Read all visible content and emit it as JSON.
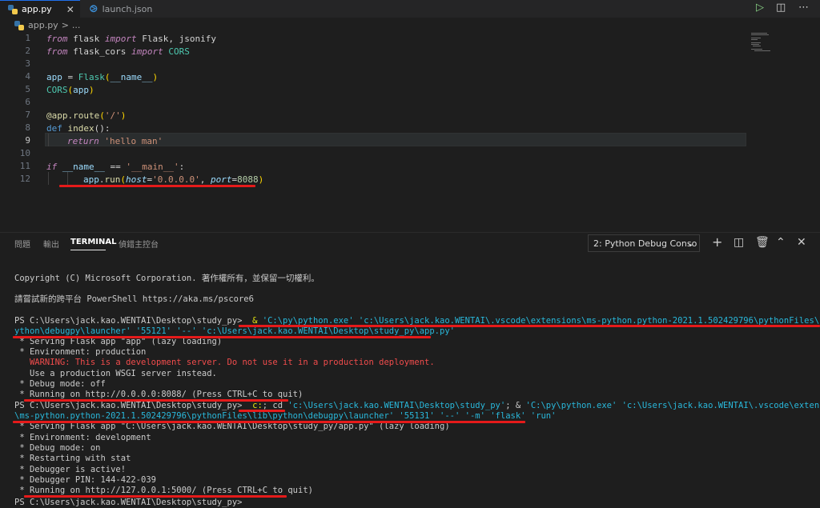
{
  "tabs": [
    {
      "label": "app.py",
      "active": true
    },
    {
      "label": "launch.json",
      "active": false
    }
  ],
  "breadcrumb": {
    "file": "app.py",
    "sep": ">",
    "rest": "..."
  },
  "editor": {
    "line_numbers": [
      "1",
      "2",
      "3",
      "4",
      "5",
      "6",
      "7",
      "8",
      "9",
      "10",
      "11",
      "12"
    ],
    "line1": {
      "t1": "from",
      "t2": " flask ",
      "t3": "import",
      "t4": " Flask, jsonify"
    },
    "line2": {
      "t1": "from",
      "t2": " flask_cors ",
      "t3": "import",
      "t4": " CORS"
    },
    "line4": {
      "t1": "app",
      "t2": " = ",
      "t3": "Flask",
      "t4": "(",
      "t5": "__name__",
      "t6": ")"
    },
    "line5": {
      "t1": "CORS",
      "t2": "(",
      "t3": "app",
      "t4": ")"
    },
    "line7": {
      "t1": "@app.route",
      "t2": "(",
      "t3": "'/'",
      "t4": ")"
    },
    "line8": {
      "t1": "def",
      "t2": " ",
      "t3": "index",
      "t4": "():"
    },
    "line9": {
      "t1": "return",
      "t2": " ",
      "t3": "'hello man'"
    },
    "line11": {
      "t1": "if",
      "t2": " ",
      "t3": "__name__",
      "t4": " == ",
      "t5": "'__main__'",
      "t6": ":"
    },
    "line12": {
      "t1": "app",
      "t2": ".",
      "t3": "run",
      "t4": "(",
      "t5": "host",
      "t6": "=",
      "t7": "'0.0.0.0'",
      "t8": ", ",
      "t9": "port",
      "t10": "=",
      "t11": "8088",
      "t12": ")"
    }
  },
  "panel": {
    "tabs": [
      "問題",
      "輸出",
      "TERMINAL",
      "偵錯主控台"
    ],
    "active_tab": "TERMINAL",
    "terminal_select": "2: Python Debug Conso"
  },
  "terminal": {
    "l1": "Copyright (C) Microsoft Corporation. 著作權所有，並保留一切權利。",
    "l2": "請嘗試新的跨平台 PowerShell https://aka.ms/pscore6",
    "l3a": "PS C:\\Users\\jack.kao.WENTAI\\Desktop\\study_py> ",
    "l3b": " & ",
    "l3c": "'C:\\py\\python.exe' 'c:\\Users\\jack.kao.WENTAI\\.vscode\\extensions\\ms-python.python-2021.1.502429796\\pythonFiles\\lib\\p",
    "l4": "ython\\debugpy\\launcher' '55121' '--' 'c:\\Users\\jack.kao.WENTAI\\Desktop\\study_py\\app.py'",
    "l5": " * Serving Flask app \"app\" (lazy loading)",
    "l6": " * Environment: production",
    "l7": "   WARNING: This is a development server. Do not use it in a production deployment.",
    "l8": "   Use a production WSGI server instead.",
    "l9": " * Debug mode: off",
    "l10": " * Running on http://0.0.0.0:8088/ (Press CTRL+C to quit)",
    "l11a": "PS C:\\Users\\jack.kao.WENTAI\\Desktop\\study_py> ",
    "l11b": " c:",
    "l11c": "; cd ",
    "l11d": "'c:\\Users\\jack.kao.WENTAI\\Desktop\\study_py'",
    "l11e": "; & ",
    "l11f": "'C:\\py\\python.exe' 'c:\\Users\\jack.kao.WENTAI\\.vscode\\extensions",
    "l12": "\\ms-python.python-2021.1.502429796\\pythonFiles\\lib\\python\\debugpy\\launcher' '55131' '--' '-m' 'flask' 'run'",
    "l13": " * Serving Flask app \"C:\\Users\\jack.kao.WENTAI\\Desktop\\study_py/app.py\" (lazy loading)",
    "l14": " * Environment: development",
    "l15": " * Debug mode: on",
    "l16": " * Restarting with stat",
    "l17": " * Debugger is active!",
    "l18": " * Debugger PIN: 144-422-039",
    "l19": " * Running on http://127.0.0.1:5000/ (Press CTRL+C to quit)",
    "l20": "PS C:\\Users\\jack.kao.WENTAI\\Desktop\\study_py>"
  },
  "colors": {
    "underline_annotation": "#e51a1a",
    "accent": "#1f6feb"
  }
}
